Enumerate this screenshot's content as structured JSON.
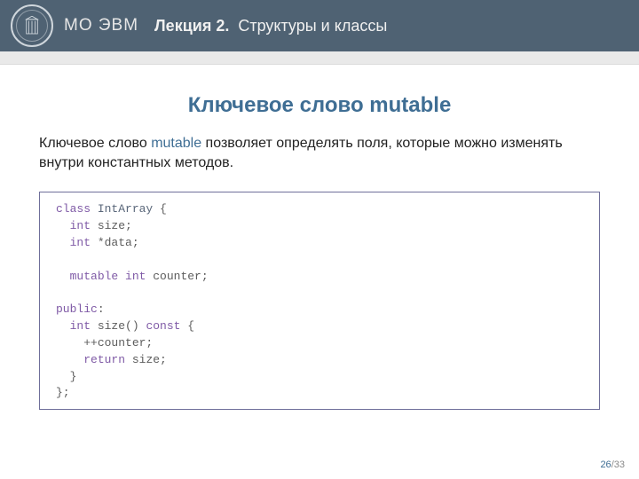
{
  "header": {
    "brand": "МО ЭВМ",
    "lecture_prefix": "Лекция 2.",
    "lecture_title": "Структуры и классы"
  },
  "title": "Ключевое слово mutable",
  "paragraph": {
    "pre": "Ключевое слово ",
    "keyword": "mutable",
    "post": " позволяет определять поля, которые можно изменять внутри константных методов."
  },
  "code": {
    "class_kw": "class",
    "class_name": "IntArray",
    "open_brace": " {",
    "field1_type": "int",
    "field1_name": "size;",
    "field2_type": "int",
    "field2_name": "*data;",
    "mutable_kw": "mutable",
    "mutable_type": "int",
    "mutable_name": "counter;",
    "public_kw": "public",
    "public_colon": ":",
    "fn_type": "int",
    "fn_name": "size()",
    "const_kw": "const",
    "fn_open": " {",
    "inc_stmt": "++counter;",
    "return_kw": "return",
    "return_val": "size;",
    "fn_close": "}",
    "class_close": "};"
  },
  "page": {
    "current": "26",
    "sep": "/",
    "total": "33"
  }
}
